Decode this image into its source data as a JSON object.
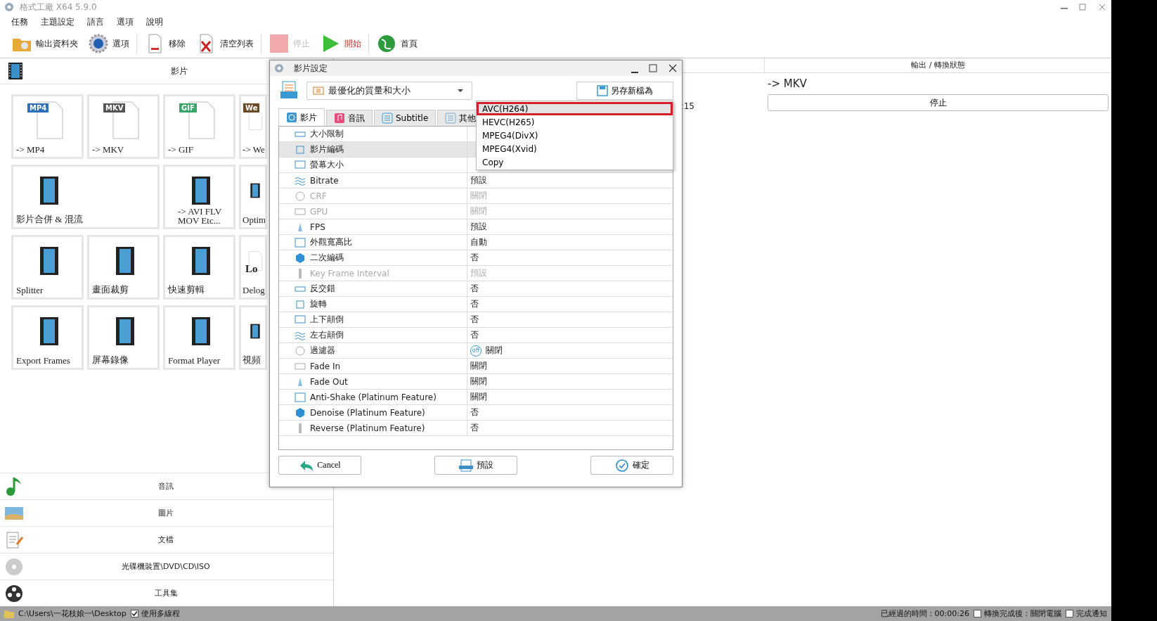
{
  "window": {
    "title": "格式工廠 X64 5.9.0"
  },
  "menu": [
    "任務",
    "主題設定",
    "語言",
    "選項",
    "說明"
  ],
  "toolbar": [
    {
      "label": "輸出資料夾",
      "disabled": false,
      "emphasized": false
    },
    {
      "label": "選項",
      "disabled": false,
      "emphasized": false
    },
    {
      "label": "移除",
      "disabled": false,
      "emphasized": false
    },
    {
      "label": "清空列表",
      "disabled": false,
      "emphasized": false
    },
    {
      "label": "停止",
      "disabled": true,
      "emphasized": false
    },
    {
      "label": "開始",
      "disabled": false,
      "emphasized": true
    },
    {
      "label": "首頁",
      "disabled": false,
      "emphasized": false
    }
  ],
  "sidebar": {
    "header": "影片",
    "tiles": [
      {
        "label": "-> MP4",
        "badge": "MP4",
        "color": "#2f6fb8"
      },
      {
        "label": "-> MKV",
        "badge": "MKV",
        "color": "#555555"
      },
      {
        "label": "-> GIF",
        "badge": "GIF",
        "color": "#3aa56a"
      },
      {
        "label": "-> We",
        "badge": "We",
        "color": "#6b4a2a"
      },
      {
        "label": "影片合併 & 混流"
      },
      {
        "label": "-> AVI FLV MOV Etc..."
      },
      {
        "label": "Optim"
      },
      {
        "label": "Splitter"
      },
      {
        "label": "畫面裁剪"
      },
      {
        "label": "快速剪輯"
      },
      {
        "label": "Delog",
        "badge": "Lo"
      },
      {
        "label": "Export Frames"
      },
      {
        "label": "屏幕錄像"
      },
      {
        "label": "Format Player"
      },
      {
        "label": "視頻"
      }
    ],
    "categories": [
      "音訊",
      "圖片",
      "文檔",
      "光碟機裝置\\DVD\\CD\\ISO",
      "工具集"
    ]
  },
  "task_list": {
    "columns": [
      "輸出 / 轉換狀態"
    ],
    "rows": [
      {
        "column_1": ":15",
        "output": "-> MKV",
        "button": "停止"
      }
    ]
  },
  "dialog": {
    "title": "影片設定",
    "preset": "最優化的質量和大小",
    "save_as": "另存新檔為",
    "tabs": [
      {
        "label": "影片",
        "selected": true
      },
      {
        "label": "音訊",
        "selected": false
      },
      {
        "label": "Subtitle",
        "selected": false
      },
      {
        "label": "其他",
        "selected": false
      }
    ],
    "properties": [
      {
        "name": "大小限制",
        "selected": false,
        "disabled": false
      },
      {
        "name": "影片編碼",
        "selected": true,
        "disabled": false
      },
      {
        "name": "螢幕大小",
        "selected": false,
        "disabled": false
      },
      {
        "name": "Bitrate",
        "value": "預設",
        "selected": false,
        "disabled": false
      },
      {
        "name": "CRF",
        "value": "關閉",
        "selected": false,
        "disabled": true
      },
      {
        "name": "GPU",
        "value": "關閉",
        "selected": false,
        "disabled": true
      },
      {
        "name": "FPS",
        "value": "預設",
        "selected": false,
        "disabled": false
      },
      {
        "name": "外觀寬高比",
        "value": "自動",
        "selected": false,
        "disabled": false
      },
      {
        "name": "二次編碼",
        "value": "否",
        "selected": false,
        "disabled": false
      },
      {
        "name": "Key Frame Interval",
        "value": "預設",
        "selected": false,
        "disabled": true
      },
      {
        "name": "反交錯",
        "value": "否",
        "selected": false,
        "disabled": false
      },
      {
        "name": "旋轉",
        "value": "否",
        "selected": false,
        "disabled": false
      },
      {
        "name": "上下顛倒",
        "value": "否",
        "selected": false,
        "disabled": false
      },
      {
        "name": "左右顛倒",
        "value": "否",
        "selected": false,
        "disabled": false
      },
      {
        "name": "過濾器",
        "value": "關閉",
        "badge": "off",
        "selected": false,
        "disabled": false
      },
      {
        "name": "Fade In",
        "value": "關閉",
        "selected": false,
        "disabled": false
      },
      {
        "name": "Fade Out",
        "value": "關閉",
        "selected": false,
        "disabled": false
      },
      {
        "name": "Anti-Shake (Platinum Feature)",
        "value": "關閉",
        "selected": false,
        "disabled": false
      },
      {
        "name": "Denoise (Platinum Feature)",
        "value": "否",
        "selected": false,
        "disabled": false
      },
      {
        "name": "Reverse (Platinum Feature)",
        "value": "否",
        "selected": false,
        "disabled": false
      }
    ],
    "dropdown": [
      {
        "label": "AVC(H264)",
        "selected": true
      },
      {
        "label": "HEVC(H265)",
        "selected": false
      },
      {
        "label": "MPEG4(DivX)",
        "selected": false
      },
      {
        "label": "MPEG4(Xvid)",
        "selected": false
      },
      {
        "label": "Copy",
        "selected": false
      }
    ],
    "buttons": [
      {
        "label": "Cancel",
        "kind": "cancel"
      },
      {
        "label": "預設",
        "kind": "default"
      },
      {
        "label": "確定",
        "kind": "ok"
      }
    ]
  },
  "status_bar": {
    "path": "C:\\Users\\一花枝娘一\\Desktop",
    "multithread": {
      "label": "使用多線程",
      "checked": true
    },
    "elapsed": "已經過的時間：00:00:26",
    "after_done": {
      "label": "轉換完成後：關閉電腦",
      "checked": false
    },
    "notify": {
      "label": "完成通知",
      "checked": false
    }
  }
}
